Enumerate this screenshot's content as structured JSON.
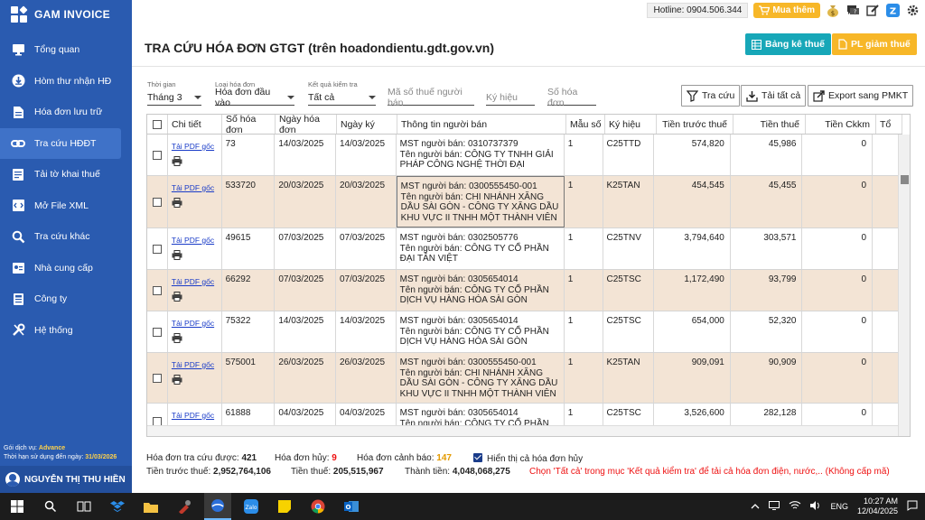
{
  "app": {
    "name": "GAM INVOICE"
  },
  "sidebar": {
    "items": [
      {
        "label": "Tổng quan",
        "icon": "monitor-icon"
      },
      {
        "label": "Hòm thư nhận HĐ",
        "icon": "inbox-download-icon"
      },
      {
        "label": "Hóa đơn lưu trữ",
        "icon": "document-icon"
      },
      {
        "label": "Tra cứu HĐĐT",
        "icon": "link-icon",
        "active": true
      },
      {
        "label": "Tải tờ khai thuế",
        "icon": "file-list-icon"
      },
      {
        "label": "Mở File XML",
        "icon": "code-file-icon"
      },
      {
        "label": "Tra cứu khác",
        "icon": "search-icon"
      },
      {
        "label": "Nhà cung cấp",
        "icon": "contact-card-icon"
      },
      {
        "label": "Công ty",
        "icon": "company-icon"
      },
      {
        "label": "Hệ thống",
        "icon": "tools-icon"
      }
    ],
    "service_label": "Gói dịch vụ:",
    "service_value": "Advance",
    "expiry_label": "Thời hạn sử dụng đến ngày:",
    "expiry_value": "31/03/2026",
    "user_name": "NGUYỄN THỊ THU HIỀN"
  },
  "topbar": {
    "hotline": "Hotline: 0904.506.344",
    "buy_label": "Mua thêm"
  },
  "header": {
    "title": "TRA CỨU HÓA ĐƠN GTGT (trên hoadondientu.gdt.gov.vn)",
    "btn_tax_list": "Bảng kê thuế",
    "btn_tax_reduction": "PL giảm thuế"
  },
  "filters": {
    "period_label": "Thời gian",
    "period_value": "Tháng 3",
    "type_label": "Loại hóa đơn",
    "type_value": "Hóa đơn đầu vào",
    "result_label": "Kết quả kiểm tra",
    "result_value": "Tất cả",
    "seller_tax_placeholder": "Mã số thuế người bán",
    "symbol_placeholder": "Ký hiệu",
    "invoice_no_placeholder": "Số hóa đơn"
  },
  "actions": {
    "search": "Tra cứu",
    "download_all": "Tải tất cả",
    "export": "Export sang PMKT"
  },
  "table": {
    "columns": [
      "Chi tiết",
      "Số hóa đơn",
      "Ngày hóa đơn",
      "Ngày ký",
      "Thông tin người bán",
      "Mẫu số",
      "Ký hiệu",
      "Tiền trước thuế",
      "Tiền thuế",
      "Tiền Ckkm",
      "Tổ"
    ],
    "pdf_label": "Tải PDF gốc",
    "rows": [
      {
        "no": "73",
        "date": "14/03/2025",
        "sign": "14/03/2025",
        "mst": "MST người bán: 0310737379",
        "name": "Tên người bán: CÔNG TY TNHH GIẢI PHÁP CÔNG NGHỆ THỜI ĐẠI",
        "form": "1",
        "symbol": "C25TTD",
        "pre": "574,820",
        "tax": "45,986",
        "ck": "0"
      },
      {
        "no": "533720",
        "date": "20/03/2025",
        "sign": "20/03/2025",
        "mst": "MST người bán: 0300555450-001",
        "name": "Tên người bán: CHI NHÁNH XĂNG DẦU SÀI GÒN - CÔNG TY XĂNG DẦU KHU VỰC II TNHH MỘT THÀNH VIÊN",
        "form": "1",
        "symbol": "K25TAN",
        "pre": "454,545",
        "tax": "45,455",
        "ck": "0"
      },
      {
        "no": "49615",
        "date": "07/03/2025",
        "sign": "07/03/2025",
        "mst": "MST người bán: 0302505776",
        "name": "Tên người bán: CÔNG TY CỔ PHẦN ĐẠI TÂN VIỆT",
        "form": "1",
        "symbol": "C25TNV",
        "pre": "3,794,640",
        "tax": "303,571",
        "ck": "0"
      },
      {
        "no": "66292",
        "date": "07/03/2025",
        "sign": "07/03/2025",
        "mst": "MST người bán: 0305654014",
        "name": "Tên người bán: CÔNG TY CỔ PHẦN DỊCH VỤ HÀNG HÓA SÀI GÒN",
        "form": "1",
        "symbol": "C25TSC",
        "pre": "1,172,490",
        "tax": "93,799",
        "ck": "0"
      },
      {
        "no": "75322",
        "date": "14/03/2025",
        "sign": "14/03/2025",
        "mst": "MST người bán: 0305654014",
        "name": "Tên người bán: CÔNG TY CỔ PHẦN DỊCH VỤ HÀNG HÓA SÀI GÒN",
        "form": "1",
        "symbol": "C25TSC",
        "pre": "654,000",
        "tax": "52,320",
        "ck": "0"
      },
      {
        "no": "575001",
        "date": "26/03/2025",
        "sign": "26/03/2025",
        "mst": "MST người bán: 0300555450-001",
        "name": "Tên người bán: CHI NHÁNH XĂNG DẦU SÀI GÒN - CÔNG TY XĂNG DẦU KHU VỰC II TNHH MỘT THÀNH VIÊN",
        "form": "1",
        "symbol": "K25TAN",
        "pre": "909,091",
        "tax": "90,909",
        "ck": "0"
      },
      {
        "no": "61888",
        "date": "04/03/2025",
        "sign": "04/03/2025",
        "mst": "MST người bán: 0305654014",
        "name": "Tên người bán: CÔNG TY CỔ PHẦN DỊCH",
        "form": "1",
        "symbol": "C25TSC",
        "pre": "3,526,600",
        "tax": "282,128",
        "ck": "0"
      }
    ]
  },
  "summary": {
    "found_label": "Hóa đơn tra cứu được:",
    "found": "421",
    "cancel_label": "Hóa đơn hủy:",
    "cancel": "9",
    "warn_label": "Hóa đơn cảnh báo:",
    "warn": "147",
    "show_cancel_label": "Hiển thị cả hóa đơn hủy",
    "pre_tax_label": "Tiền trước thuế:",
    "pre_tax": "2,952,764,106",
    "tax_label": "Tiền thuế:",
    "tax": "205,515,967",
    "total_label": "Thành tiền:",
    "total": "4,048,068,275",
    "note": "Chọn 'Tất cả' trong mục 'Kết quả kiểm tra' để tải cả hóa đơn điện, nước,.. (Không cấp mã)"
  },
  "taskbar": {
    "lang": "ENG",
    "time": "10:27 AM",
    "date": "12/04/2025"
  }
}
